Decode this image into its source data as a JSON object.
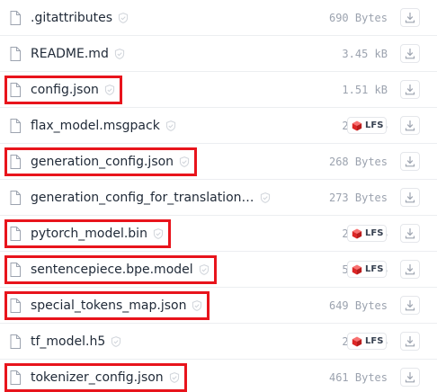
{
  "files": [
    {
      "name": ".gitattributes",
      "size": "690 Bytes",
      "lfs": false,
      "highlighted": false
    },
    {
      "name": "README.md",
      "size": "3.45 kB",
      "lfs": false,
      "highlighted": false
    },
    {
      "name": "config.json",
      "size": "1.51 kB",
      "lfs": false,
      "highlighted": true
    },
    {
      "name": "flax_model.msgpack",
      "size": "2.44 GB",
      "lfs": true,
      "highlighted": false
    },
    {
      "name": "generation_config.json",
      "size": "268 Bytes",
      "lfs": false,
      "highlighted": true
    },
    {
      "name": "generation_config_for_translation…",
      "size": "273 Bytes",
      "lfs": false,
      "highlighted": false
    },
    {
      "name": "pytorch_model.bin",
      "size": "2.44 GB",
      "lfs": true,
      "highlighted": true
    },
    {
      "name": "sentencepiece.bpe.model",
      "size": "5.07 MB",
      "lfs": true,
      "highlighted": true
    },
    {
      "name": "special_tokens_map.json",
      "size": "649 Bytes",
      "lfs": false,
      "highlighted": true
    },
    {
      "name": "tf_model.h5",
      "size": "2.45 GB",
      "lfs": true,
      "highlighted": false
    },
    {
      "name": "tokenizer_config.json",
      "size": "461 Bytes",
      "lfs": false,
      "highlighted": true
    }
  ],
  "lfs_badge_label": "LFS",
  "icons": {
    "file": "file-icon",
    "safe": "safe-check-icon",
    "lfs": "lfs-cube-icon",
    "download": "download-icon"
  },
  "colors": {
    "highlight": "#e8141c",
    "lfs_icon": "#e23b3b",
    "text": "#1f2937",
    "size_text": "#9ca3af",
    "divider": "#eceef1"
  }
}
